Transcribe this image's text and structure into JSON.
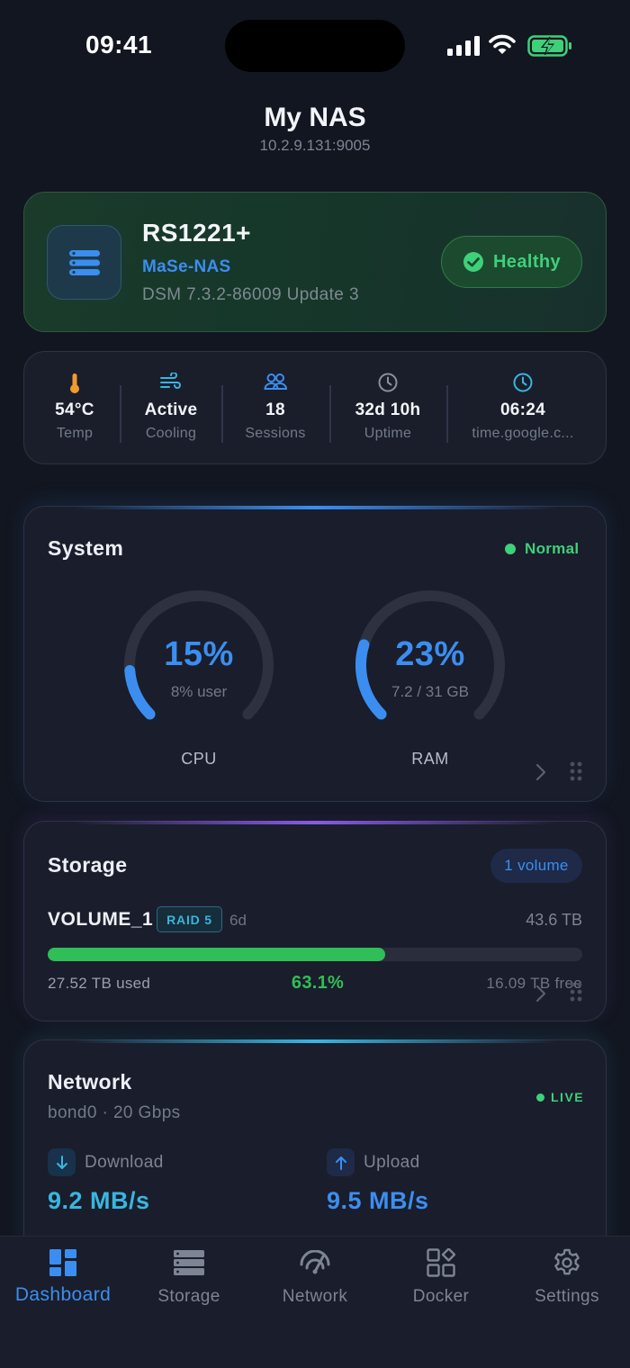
{
  "status_bar": {
    "time": "09:41"
  },
  "header": {
    "title": "My NAS",
    "address": "10.2.9.131:9005"
  },
  "device": {
    "model": "RS1221+",
    "hostname": "MaSe-NAS",
    "dsm_version": "DSM 7.3.2-86009 Update 3",
    "health_label": "Healthy",
    "icon": "server-icon"
  },
  "stats": [
    {
      "icon": "thermometer-icon",
      "value": "54°C",
      "label": "Temp",
      "color": "#f29a2e"
    },
    {
      "icon": "wind-icon",
      "value": "Active",
      "label": "Cooling",
      "color": "#38b6e0"
    },
    {
      "icon": "users-icon",
      "value": "18",
      "label": "Sessions",
      "color": "#3b8ef0"
    },
    {
      "icon": "clock-icon",
      "value": "32d 10h",
      "label": "Uptime",
      "color": "#8a909c"
    },
    {
      "icon": "clock-icon",
      "value": "06:24",
      "label": "time.google.c...",
      "color": "#38b6e0"
    }
  ],
  "system": {
    "title": "System",
    "status": "Normal",
    "cpu": {
      "percent": 15,
      "value": "15%",
      "sub": "8% user",
      "label": "CPU"
    },
    "ram": {
      "percent": 23,
      "value": "23%",
      "sub": "7.2 / 31 GB",
      "label": "RAM"
    }
  },
  "storage": {
    "title": "Storage",
    "volume_count": "1 volume",
    "volume": {
      "name": "VOLUME_1",
      "raid": "RAID 5",
      "age": "6d",
      "total": "43.6 TB",
      "used": "27.52 TB used",
      "percent_label": "63.1%",
      "percent": 63.1,
      "free": "16.09 TB free"
    }
  },
  "network": {
    "title": "Network",
    "interface": "bond0",
    "speed": "20 Gbps",
    "live_label": "LIVE",
    "download_label": "Download",
    "download_rate": "9.2 MB/s",
    "upload_label": "Upload",
    "upload_rate": "9.5 MB/s"
  },
  "tabs": [
    {
      "label": "Dashboard",
      "icon": "dashboard-icon",
      "active": true
    },
    {
      "label": "Storage",
      "icon": "storage-icon",
      "active": false
    },
    {
      "label": "Network",
      "icon": "network-icon",
      "active": false
    },
    {
      "label": "Docker",
      "icon": "docker-icon",
      "active": false
    },
    {
      "label": "Settings",
      "icon": "gear-icon",
      "active": false
    }
  ],
  "colors": {
    "accent": "#3b8ef0",
    "success": "#3ed07a",
    "cyan": "#38b6e0",
    "background": "#121620",
    "card": "#1a1d2b"
  }
}
